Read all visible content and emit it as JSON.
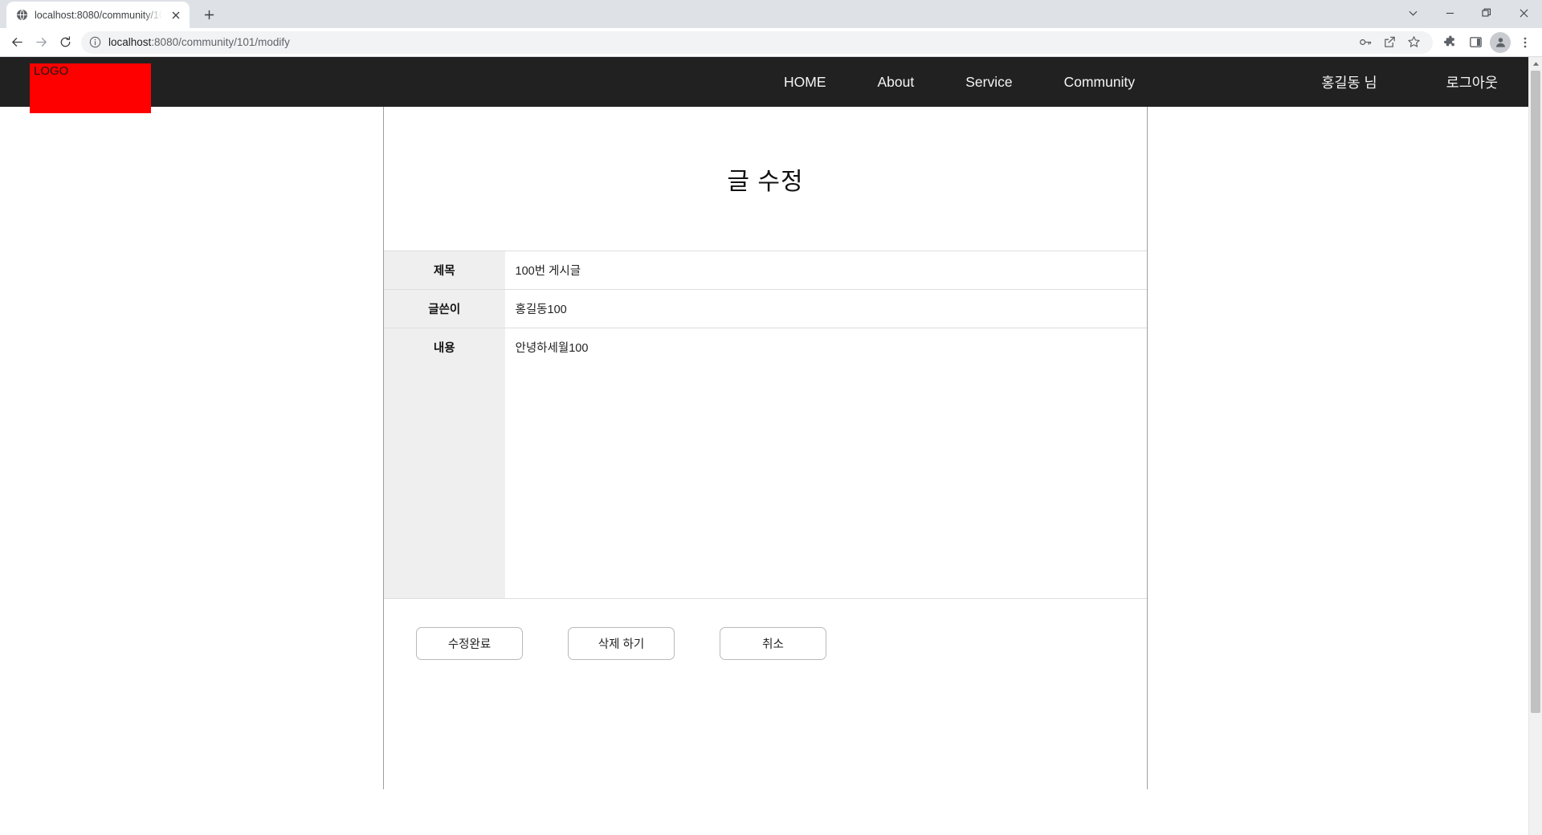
{
  "browser": {
    "tab": {
      "favicon": "globe-icon",
      "title": "localhost:8080/community/101/",
      "close_label": "✕"
    },
    "newtab_label": "+",
    "window_controls": {
      "tab_search": "tab-search-icon",
      "minimize": "minimize-icon",
      "maximize": "maximize-icon",
      "close": "close-icon"
    },
    "toolbar": {
      "back_label": "back-icon",
      "forward_label": "forward-icon",
      "reload_label": "reload-icon",
      "url_secure_prefix": "localhost",
      "url_rest": ":8080/community/101/modify",
      "url_full": "localhost:8080/community/101/modify",
      "icons": [
        "key-icon",
        "share-icon",
        "bookmark-star-icon",
        "extensions-icon",
        "side-panel-icon",
        "profile-avatar",
        "chrome-menu-icon"
      ]
    }
  },
  "site": {
    "nav": {
      "logo_text": "LOGO",
      "logo_color": "#ff0000",
      "bar_color": "#212121",
      "links": [
        {
          "label": "HOME"
        },
        {
          "label": "About"
        },
        {
          "label": "Service"
        },
        {
          "label": "Community"
        }
      ],
      "user_label": "홍길동 님",
      "logout_label": "로그아웃"
    },
    "page": {
      "title": "글 수정",
      "fields": [
        {
          "label": "제목",
          "value": "100번 게시글"
        },
        {
          "label": "글쓴이",
          "value": "홍길동100"
        },
        {
          "label": "내용",
          "value": "안녕하세월100"
        }
      ],
      "buttons": [
        {
          "label": "수정완료"
        },
        {
          "label": "삭제 하기"
        },
        {
          "label": "취소"
        }
      ]
    }
  }
}
